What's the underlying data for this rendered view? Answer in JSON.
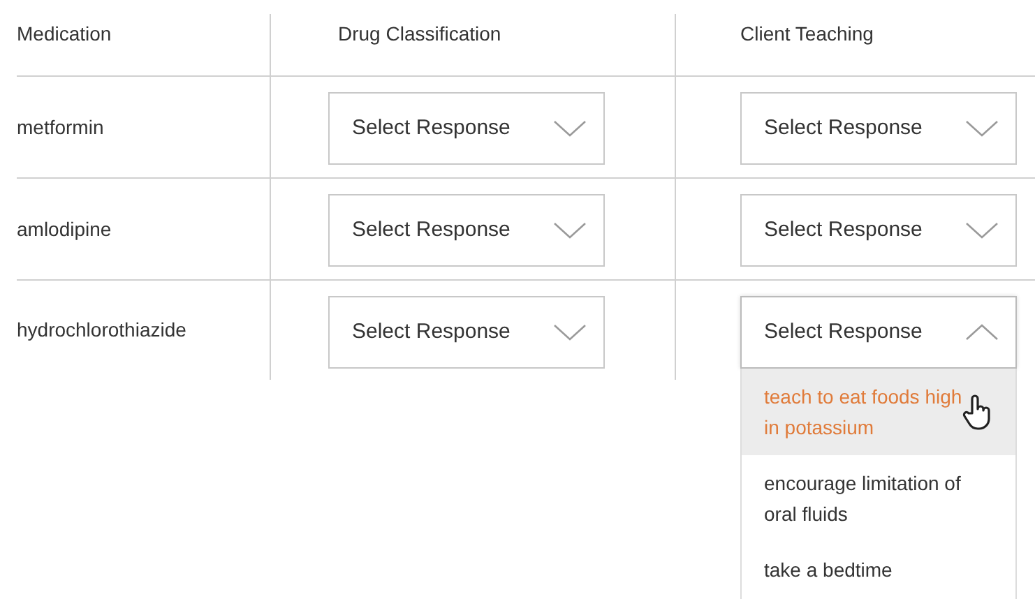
{
  "columns": [
    "Medication",
    "Drug Classification",
    "Client Teaching"
  ],
  "rows": [
    {
      "name": "metformin",
      "responses": [
        {
          "value": "Select Response",
          "expanded": false
        },
        {
          "value": "Select Response",
          "expanded": false
        }
      ]
    },
    {
      "name": "amlodipine",
      "responses": [
        {
          "value": "Select Response",
          "expanded": false
        },
        {
          "value": "Select Response",
          "expanded": false
        }
      ]
    },
    {
      "name": "hydrochlorothiazide",
      "responses": [
        {
          "value": "Select Response",
          "expanded": false
        },
        {
          "value": "Select Response",
          "expanded": true,
          "options": [
            {
              "label": "teach to eat foods high in potassium",
              "highlighted": true
            },
            {
              "label": "encourage limitation of oral fluids",
              "highlighted": false
            },
            {
              "label": "take a bedtime",
              "highlighted": false
            }
          ]
        }
      ]
    }
  ]
}
